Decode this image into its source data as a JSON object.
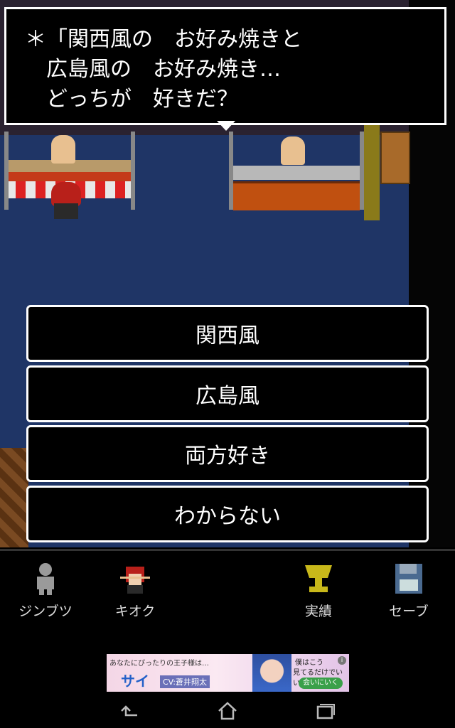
{
  "dialog": {
    "lines": [
      "＊「関西風の　お好み焼きと",
      "　広島風の　お好み焼き…",
      "　どっちが　好きだ？"
    ]
  },
  "choices": [
    {
      "label": "関西風"
    },
    {
      "label": "広島風"
    },
    {
      "label": "両方好き"
    },
    {
      "label": "わからない"
    }
  ],
  "toolbar": {
    "people_label": "ジンブツ",
    "memory_label": "キオク",
    "achievements_label": "実績",
    "save_label": "セーブ"
  },
  "ad": {
    "headline": "あなたにぴったりの王子様は…",
    "brand": "サイ",
    "cv": "CV:蒼井翔太",
    "tagline1": "僕はこう",
    "tagline2": "見てるだけでいいよ",
    "cta": "会いにいく"
  },
  "colors": {
    "scene_floor": "#1f3566",
    "window_border": "#ffffff",
    "hero_hair": "#b8201a",
    "trophy": "#c8b81a",
    "save_icon": "#4a6a90"
  },
  "icons": {
    "people": "person-silhouette-icon",
    "memory": "red-hair-portrait-icon",
    "achievements": "trophy-icon",
    "save": "floppy-disk-icon",
    "nav_back": "back-arrow-icon",
    "nav_home": "home-icon",
    "nav_recent": "recent-apps-icon"
  }
}
